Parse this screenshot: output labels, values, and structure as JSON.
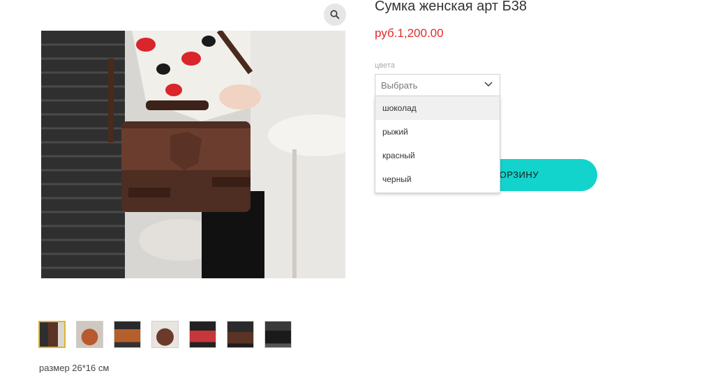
{
  "product": {
    "title": "Сумка женская арт Б38",
    "price": "руб.1,200.00",
    "description": "размер 26*16 см"
  },
  "color_select": {
    "label": "цвета",
    "value": "Выбрать",
    "options": [
      "шоколад",
      "рыжий",
      "красный",
      "черный"
    ],
    "hovered_option": "шоколад"
  },
  "cart_button": {
    "label": "В КОРЗИНУ",
    "visible_label": "ОРЗИНУ",
    "color": "#13d4cc"
  },
  "gallery": {
    "thumbnail_count": 7,
    "active_thumbnail": 1,
    "zoom_icon": "magnifier-icon"
  },
  "colors": {
    "price": "#e02b27",
    "accent": "#13d4cc",
    "active_border": "#e0b32c"
  }
}
